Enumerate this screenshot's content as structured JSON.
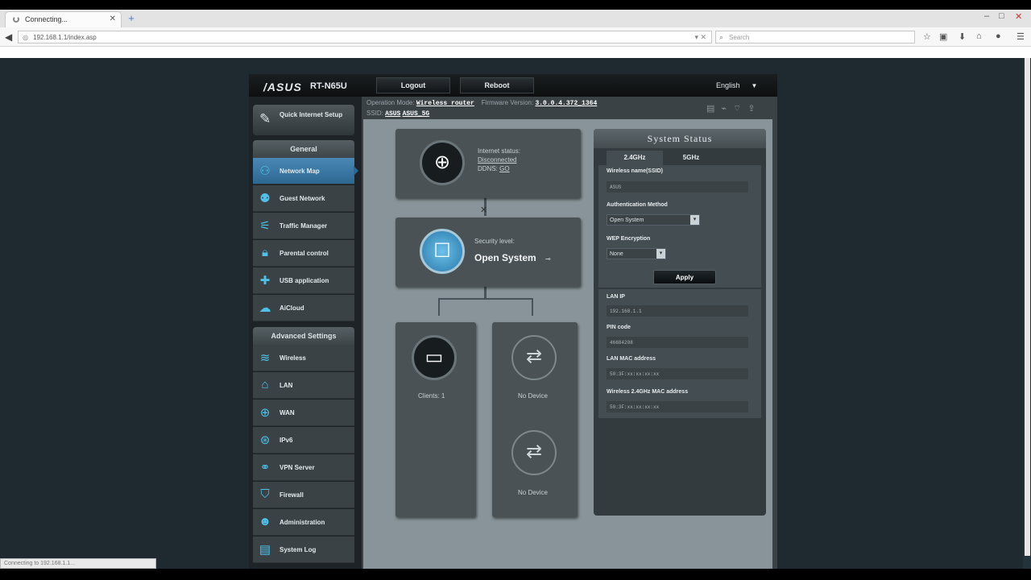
{
  "browser": {
    "tab_title": "Connecting...",
    "url": "192.168.1.1/index.asp",
    "search_placeholder": "Search",
    "status_text": "Connecting to 192.168.1.1..."
  },
  "router": {
    "brand": "/ASUS",
    "model": "RT-N65U",
    "header": {
      "logout": "Logout",
      "reboot": "Reboot",
      "language": "English"
    },
    "info": {
      "op_mode_label": "Operation Mode:",
      "op_mode_value": "Wireless router",
      "firmware_label": "Firmware Version:",
      "firmware_value": "3.0.0.4.372_1364",
      "ssid_label": "SSID:",
      "ssid_value_1": "ASUS",
      "ssid_value_2": "ASUS_5G"
    },
    "sidebar": {
      "quick_setup": "Quick Internet Setup",
      "general_title": "General",
      "general": [
        {
          "label": "Network Map",
          "icon": "network-map-icon"
        },
        {
          "label": "Guest Network",
          "icon": "guest-network-icon"
        },
        {
          "label": "Traffic Manager",
          "icon": "traffic-manager-icon"
        },
        {
          "label": "Parental control",
          "icon": "lock-icon"
        },
        {
          "label": "USB application",
          "icon": "puzzle-icon"
        },
        {
          "label": "AiCloud",
          "icon": "cloud-icon"
        }
      ],
      "advanced_title": "Advanced Settings",
      "advanced": [
        {
          "label": "Wireless",
          "icon": "wifi-icon"
        },
        {
          "label": "LAN",
          "icon": "home-icon"
        },
        {
          "label": "WAN",
          "icon": "globe-icon"
        },
        {
          "label": "IPv6",
          "icon": "ipv6-icon"
        },
        {
          "label": "VPN Server",
          "icon": "vpn-icon"
        },
        {
          "label": "Firewall",
          "icon": "shield-icon"
        },
        {
          "label": "Administration",
          "icon": "person-icon"
        },
        {
          "label": "System Log",
          "icon": "log-icon"
        }
      ]
    },
    "map": {
      "internet_status_label": "Internet status:",
      "internet_status_value": "Disconnected",
      "ddns_label": "DDNS:",
      "ddns_value": "GO",
      "security_label": "Security level:",
      "security_value": "Open System",
      "clients_label": "Clients:",
      "clients_value": "1",
      "usb1": "No Device",
      "usb2": "No Device"
    },
    "status": {
      "title": "System Status",
      "tab_24": "2.4GHz",
      "tab_5": "5GHz",
      "ssid_label": "Wireless name(SSID)",
      "ssid_value": "ASUS",
      "auth_label": "Authentication Method",
      "auth_value": "Open System",
      "wep_label": "WEP Encryption",
      "wep_value": "None",
      "apply": "Apply",
      "lan_ip_label": "LAN IP",
      "lan_ip_value": "192.168.1.1",
      "pin_label": "PIN code",
      "pin_value": "46684208",
      "lan_mac_label": "LAN MAC address",
      "lan_mac_value": "50:3F:xx:xx:xx:xx",
      "wmac_label": "Wireless 2.4GHz MAC address",
      "wmac_value": "50:3F:xx:xx:xx:xx"
    }
  }
}
